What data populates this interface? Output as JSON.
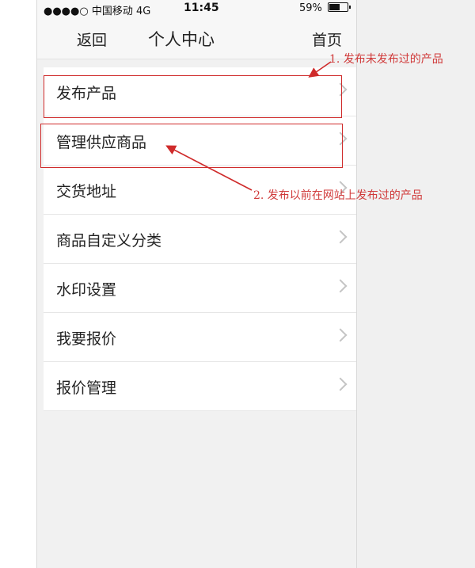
{
  "status_bar": {
    "carrier": "●●●●○ 中国移动  4G",
    "time": "11:45",
    "battery_text": "59%",
    "battery_level": 0.59
  },
  "nav": {
    "back_label": "返回",
    "title": "个人中心",
    "home_label": "首页"
  },
  "menu": {
    "items": [
      {
        "label": "发布产品"
      },
      {
        "label": "管理供应商品"
      },
      {
        "label": "交货地址"
      },
      {
        "label": "商品自定义分类"
      },
      {
        "label": "水印设置"
      },
      {
        "label": "我要报价"
      },
      {
        "label": "报价管理"
      }
    ]
  },
  "annotations": {
    "note1": "1. 发布未发布过的产品",
    "note2": "2. 发布以前在网站上发布过的产品",
    "color": "#d03a3a"
  }
}
